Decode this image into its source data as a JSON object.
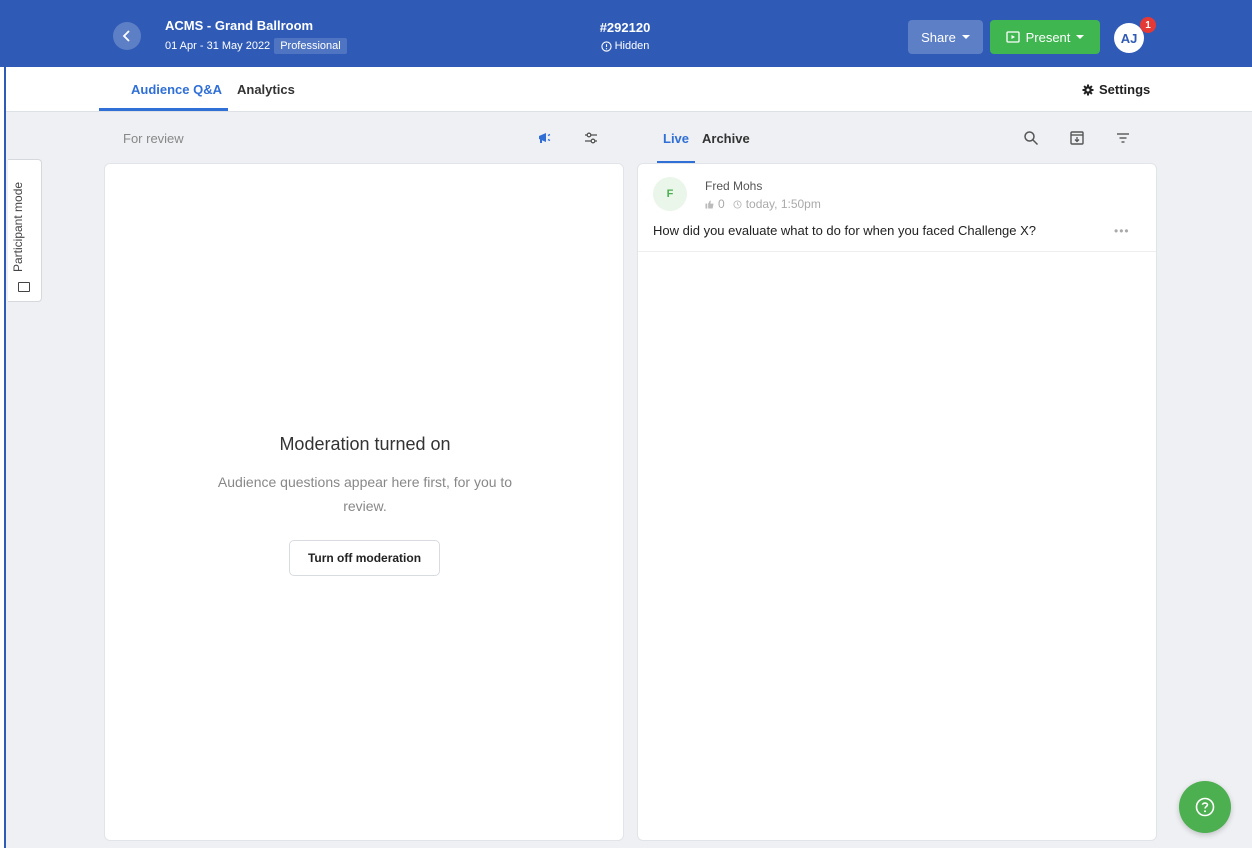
{
  "header": {
    "event_title": "ACMS - Grand Ballroom",
    "event_dates": "01 Apr - 31 May 2022",
    "plan_badge": "Professional",
    "event_code": "#292120",
    "visibility": "Hidden",
    "share_label": "Share",
    "present_label": "Present",
    "user_initials": "AJ",
    "notification_count": "1"
  },
  "tabs": {
    "qa": "Audience Q&A",
    "analytics": "Analytics",
    "settings": "Settings"
  },
  "participant_mode": "Participant mode",
  "review": {
    "header": "For review",
    "empty_title": "Moderation turned on",
    "empty_desc": "Audience questions appear here first, for you to review.",
    "turn_off_label": "Turn off moderation"
  },
  "live": {
    "tab_live": "Live",
    "tab_archive": "Archive",
    "questions": [
      {
        "initial": "F",
        "author": "Fred Mohs",
        "likes": "0",
        "time": "today, 1:50pm",
        "text": "How did you evaluate what to do for when you faced Challenge X?"
      }
    ]
  },
  "colors": {
    "brand_blue": "#2f5bb7",
    "accent_blue": "#2f6fd6",
    "present_green": "#3fb650"
  }
}
